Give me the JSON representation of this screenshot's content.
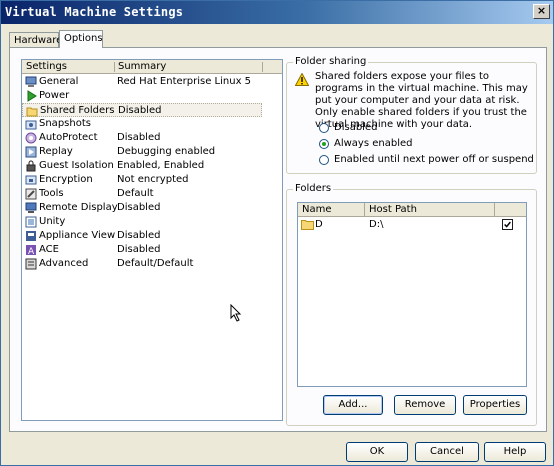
{
  "window": {
    "title": "Virtual Machine Settings",
    "close_glyph": "×"
  },
  "tabs": [
    {
      "label": "Hardware"
    },
    {
      "label": "Options"
    }
  ],
  "settings": {
    "headers": [
      "Settings",
      "Summary"
    ],
    "items": [
      {
        "name": "General",
        "summary": "Red Hat Enterprise Linux 5",
        "icon": "general-icon"
      },
      {
        "name": "Power",
        "summary": "",
        "icon": "power-icon"
      },
      {
        "name": "Shared Folders",
        "summary": "Disabled",
        "icon": "folder-icon"
      },
      {
        "name": "Snapshots",
        "summary": "",
        "icon": "snapshot-icon"
      },
      {
        "name": "AutoProtect",
        "summary": "Disabled",
        "icon": "autoprotect-icon"
      },
      {
        "name": "Replay",
        "summary": "Debugging enabled",
        "icon": "replay-icon"
      },
      {
        "name": "Guest Isolation",
        "summary": "Enabled, Enabled",
        "icon": "lock-icon"
      },
      {
        "name": "Encryption",
        "summary": "Not encrypted",
        "icon": "encryption-icon"
      },
      {
        "name": "Tools",
        "summary": "Default",
        "icon": "tools-icon"
      },
      {
        "name": "Remote Display",
        "summary": "Disabled",
        "icon": "display-icon"
      },
      {
        "name": "Unity",
        "summary": "",
        "icon": "unity-icon"
      },
      {
        "name": "Appliance View",
        "summary": "Disabled",
        "icon": "appliance-icon"
      },
      {
        "name": "ACE",
        "summary": "Disabled",
        "icon": "ace-icon"
      },
      {
        "name": "Advanced",
        "summary": "Default/Default",
        "icon": "advanced-icon"
      }
    ]
  },
  "folder_sharing": {
    "legend": "Folder sharing",
    "warning": "Shared folders expose your files to programs in the virtual machine. This may put your computer and your data at risk. Only enable shared folders if you trust the virtual machine with your data.",
    "options": [
      {
        "label": "Disabled",
        "checked": false
      },
      {
        "label": "Always enabled",
        "checked": true
      },
      {
        "label": "Enabled until next power off or suspend",
        "checked": false
      }
    ]
  },
  "folders": {
    "legend": "Folders",
    "headers": [
      "Name",
      "Host Path"
    ],
    "rows": [
      {
        "name": "D",
        "path": "D:\\",
        "enabled": true
      }
    ],
    "buttons": {
      "add": "Add...",
      "remove": "Remove",
      "properties": "Properties"
    }
  },
  "footer": {
    "ok": "OK",
    "cancel": "Cancel",
    "help": "Help"
  },
  "colors": {
    "title_start": "#0a246a",
    "title_end": "#a6caf0",
    "dialog_bg": "#ece9d8",
    "panel_bg": "#fcfcfe"
  }
}
